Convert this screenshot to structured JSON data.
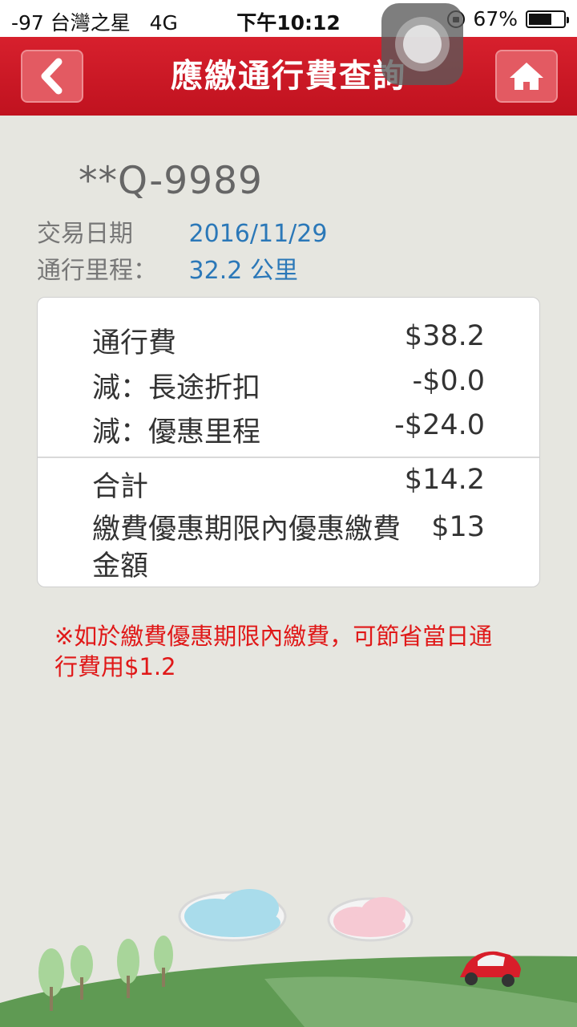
{
  "status_bar": {
    "carrier": "-97 台灣之星",
    "network": "4G",
    "time": "下午10:12",
    "battery": "67%",
    "battery_level": 0.67
  },
  "header": {
    "title": "應繳通行費查詢"
  },
  "vehicle": {
    "plate": "**Q-9989"
  },
  "info": {
    "date_label": "交易日期",
    "date_value": "2016/11/29",
    "mileage_label": "通行里程：",
    "mileage_value": "32.2 公里"
  },
  "fees": {
    "toll_label": "通行費",
    "toll_amount": "$38.2",
    "long_discount_label": "減：長途折扣",
    "long_discount_amount": "-$0.0",
    "free_mileage_label": "減：優惠里程",
    "free_mileage_amount": "-$24.0",
    "total_label": "合計",
    "total_amount": "$14.2",
    "promo_label": "繳費優惠期限內優惠繳費金額",
    "promo_amount": "$13"
  },
  "note": "※如於繳費優惠期限內繳費，可節省當日通行費用$1.2",
  "colors": {
    "header_red": "#c8161f",
    "value_blue": "#2b78b8",
    "note_red": "#e01818",
    "background": "#e6e6e0"
  },
  "icons": [
    "lock-rotation-icon",
    "battery-icon",
    "back-icon",
    "home-icon",
    "assistive-touch-icon"
  ]
}
